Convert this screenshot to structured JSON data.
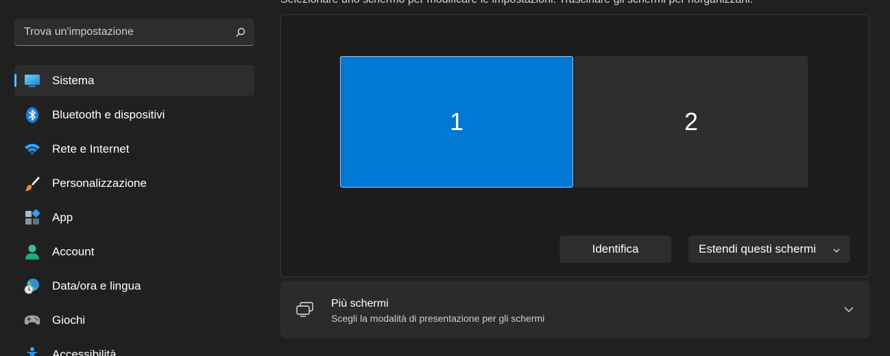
{
  "search": {
    "placeholder": "Trova un'impostazione",
    "icon": "search-icon"
  },
  "nav": {
    "items": [
      {
        "label": "Sistema",
        "icon": "system-display-icon",
        "active": true
      },
      {
        "label": "Bluetooth e dispositivi",
        "icon": "bluetooth-icon"
      },
      {
        "label": "Rete e Internet",
        "icon": "wifi-icon"
      },
      {
        "label": "Personalizzazione",
        "icon": "brush-icon"
      },
      {
        "label": "App",
        "icon": "apps-icon"
      },
      {
        "label": "Account",
        "icon": "account-icon"
      },
      {
        "label": "Data/ora e lingua",
        "icon": "globe-clock-icon"
      },
      {
        "label": "Giochi",
        "icon": "gamepad-icon"
      },
      {
        "label": "Accessibilità",
        "icon": "accessibility-icon"
      }
    ]
  },
  "display": {
    "hint": "Selezionare uno schermo per modificare le impostazioni. Trascinare gli schermi per riorganizzarli.",
    "monitors": [
      "1",
      "2"
    ],
    "identify_label": "Identifica",
    "mode_label": "Estendi questi schermi"
  },
  "multiple": {
    "title": "Più schermi",
    "subtitle": "Scegli la modalità di presentazione per gli schermi",
    "icon": "multiple-displays-icon"
  },
  "colors": {
    "accent": "#0078d4",
    "active_indicator": "#4cc2ff",
    "background": "#202020",
    "card": "#2b2b2b"
  }
}
